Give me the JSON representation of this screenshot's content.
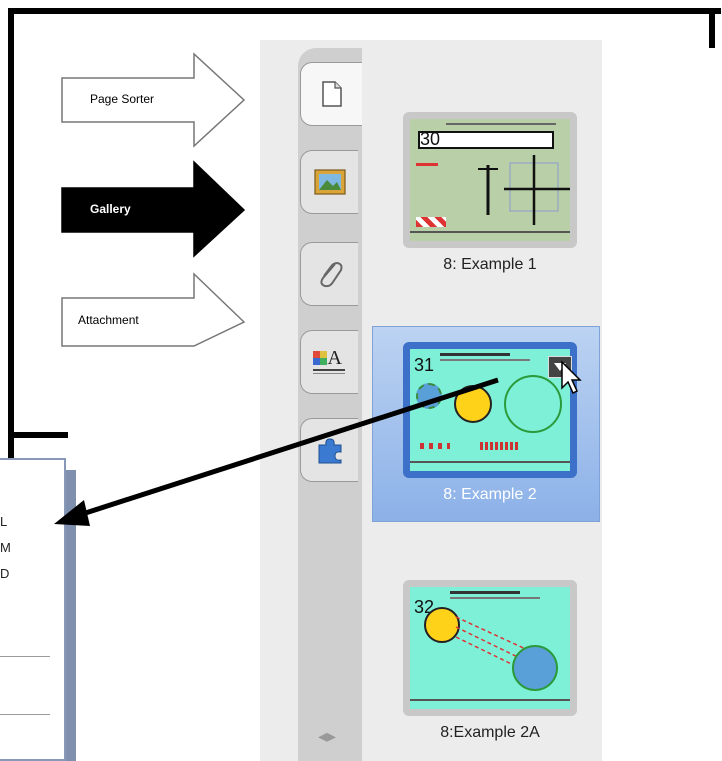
{
  "callouts": [
    {
      "label": "Page Sorter",
      "style": "outline"
    },
    {
      "label": "Gallery",
      "style": "filled"
    },
    {
      "label": "Attachment",
      "style": "outline"
    }
  ],
  "sidebar": {
    "tabs": [
      {
        "name": "page-sorter",
        "icon": "page-icon",
        "active": true
      },
      {
        "name": "gallery",
        "icon": "picture-icon"
      },
      {
        "name": "attachments",
        "icon": "paperclip-icon"
      },
      {
        "name": "properties",
        "icon": "text-color-icon",
        "icon_text": "A"
      },
      {
        "name": "addons",
        "icon": "puzzle-icon"
      }
    ],
    "pages": [
      {
        "number": "30",
        "caption": "8: Example 1",
        "selected": false
      },
      {
        "number": "31",
        "caption": "8: Example 2",
        "selected": true
      },
      {
        "number": "32",
        "caption": "8:Example 2A",
        "selected": false
      }
    ],
    "resize_handle": "◂▸"
  },
  "menu": {
    "items": [
      "L",
      "M",
      "D"
    ]
  },
  "colors": {
    "selection": "#8cb1e8",
    "thumb_green": "#b9cfa8",
    "thumb_aqua": "#7ff0d8"
  }
}
